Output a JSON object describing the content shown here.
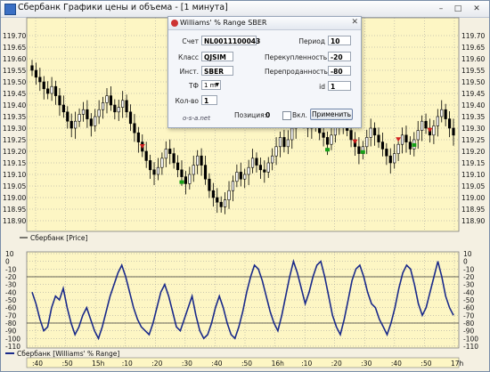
{
  "window": {
    "title": "Сбербанк Графики цены и объема - [1 минута]",
    "minimize": "–",
    "maximize": "□",
    "close": "✕"
  },
  "price_panel": {
    "label": "Сбербанк [Price]",
    "y_ticks": [
      "119.70",
      "119.65",
      "119.60",
      "119.55",
      "119.50",
      "119.45",
      "119.40",
      "119.35",
      "119.30",
      "119.25",
      "119.20",
      "119.15",
      "119.10",
      "119.05",
      "119.00",
      "118.95",
      "118.90"
    ]
  },
  "wr_panel": {
    "label": "Сбербанк [Williams' % Range]",
    "y_ticks": [
      "10",
      "0",
      "-10",
      "-20",
      "-30",
      "-40",
      "-50",
      "-60",
      "-70",
      "-80",
      "-90",
      "-100",
      "-110"
    ]
  },
  "x_axis": {
    "ticks": [
      ":40",
      ":50",
      "15h",
      ":10",
      ":20",
      ":30",
      ":40",
      ":50",
      "16h",
      ":10",
      ":20",
      ":30",
      ":40",
      ":50",
      "17h"
    ]
  },
  "colors": {
    "plot_bg": "#fdf6c4",
    "grid": "#a0a0a0",
    "candle": "#000000",
    "wr_line": "#1a2a8a",
    "buy_marker": "#18a018",
    "sell_marker": "#d02020"
  },
  "dialog": {
    "title": "Williams' % Range SBER",
    "close": "✕",
    "fields": {
      "account_label": "Счет",
      "account_value": "NL0011100043",
      "class_label": "Класс",
      "class_value": "QJSIM",
      "instrument_label": "Инст.",
      "instrument_value": "SBER",
      "tf_label": "ТФ",
      "tf_value": "1 m",
      "qty_label": "Кол-во",
      "qty_value": "1",
      "period_label": "Период",
      "period_value": "10",
      "overbought_label": "Перекупленность",
      "overbought_value": "-20",
      "oversold_label": "Перепроданность",
      "oversold_value": "-80",
      "id_label": "id",
      "id_value": "1"
    },
    "link": "o-s-a.net",
    "position_label": "Позиция:",
    "position_value": "0",
    "enabled_label": "Вкл.",
    "enabled_checked": false,
    "apply_label": "Применить"
  },
  "chart_data": [
    {
      "type": "candlestick",
      "title": "",
      "series_label": "Сбербанк [Price]",
      "ylim": [
        118.87,
        119.72
      ],
      "close": [
        119.55,
        119.52,
        119.5,
        119.47,
        119.45,
        119.48,
        119.44,
        119.4,
        119.37,
        119.33,
        119.3,
        119.33,
        119.36,
        119.38,
        119.34,
        119.31,
        119.35,
        119.38,
        119.41,
        119.44,
        119.4,
        119.37,
        119.39,
        119.42,
        119.37,
        119.32,
        119.28,
        119.24,
        119.2,
        119.16,
        119.12,
        119.1,
        119.13,
        119.17,
        119.21,
        119.19,
        119.15,
        119.12,
        119.09,
        119.06,
        119.1,
        119.14,
        119.18,
        119.14,
        119.08,
        119.03,
        119.0,
        118.98,
        118.96,
        118.99,
        119.03,
        119.07,
        119.11,
        119.08,
        119.1,
        119.13,
        119.17,
        119.14,
        119.12,
        119.11,
        119.15,
        119.18,
        119.22,
        119.26,
        119.22,
        119.25,
        119.3,
        119.33,
        119.36,
        119.33,
        119.3,
        119.34,
        119.31,
        119.28,
        119.26,
        119.23,
        119.27,
        119.31,
        119.35,
        119.32,
        119.29,
        119.25,
        119.22,
        119.19,
        119.22,
        119.26,
        119.3,
        119.27,
        119.24,
        119.21,
        119.18,
        119.15,
        119.19,
        119.23,
        119.27,
        119.24,
        119.21,
        119.25,
        119.29,
        119.33,
        119.3,
        119.27,
        119.31,
        119.35,
        119.38,
        119.34,
        119.3,
        119.27
      ],
      "signals": [
        {
          "kind": "sell",
          "index": 28
        },
        {
          "kind": "buy",
          "index": 38
        },
        {
          "kind": "buy",
          "index": 75
        },
        {
          "kind": "sell",
          "index": 82
        },
        {
          "kind": "buy",
          "index": 84
        },
        {
          "kind": "sell",
          "index": 93
        },
        {
          "kind": "buy",
          "index": 97
        },
        {
          "kind": "sell",
          "index": 101
        }
      ]
    },
    {
      "type": "line",
      "title": "",
      "series": [
        {
          "name": "Сбербанк [Williams' % Range]",
          "values": [
            -40,
            -55,
            -75,
            -90,
            -85,
            -60,
            -45,
            -50,
            -35,
            -60,
            -80,
            -95,
            -85,
            -70,
            -60,
            -75,
            -90,
            -100,
            -85,
            -65,
            -45,
            -30,
            -15,
            -5,
            -20,
            -40,
            -60,
            -75,
            -85,
            -90,
            -95,
            -80,
            -60,
            -40,
            -30,
            -45,
            -65,
            -85,
            -90,
            -75,
            -60,
            -45,
            -70,
            -90,
            -100,
            -95,
            -80,
            -60,
            -45,
            -60,
            -80,
            -95,
            -100,
            -85,
            -65,
            -40,
            -20,
            -5,
            -10,
            -25,
            -45,
            -65,
            -80,
            -90,
            -70,
            -45,
            -20,
            0,
            -15,
            -35,
            -55,
            -40,
            -20,
            -5,
            0,
            -20,
            -45,
            -70,
            -85,
            -95,
            -75,
            -50,
            -25,
            -10,
            -5,
            -20,
            -40,
            -55,
            -60,
            -75,
            -85,
            -95,
            -80,
            -60,
            -35,
            -15,
            -5,
            -10,
            -30,
            -55,
            -70,
            -60,
            -40,
            -20,
            0,
            -20,
            -45,
            -60,
            -70
          ]
        }
      ],
      "ylim": [
        -110,
        10
      ],
      "ylabel": "",
      "xlabel": ""
    }
  ]
}
